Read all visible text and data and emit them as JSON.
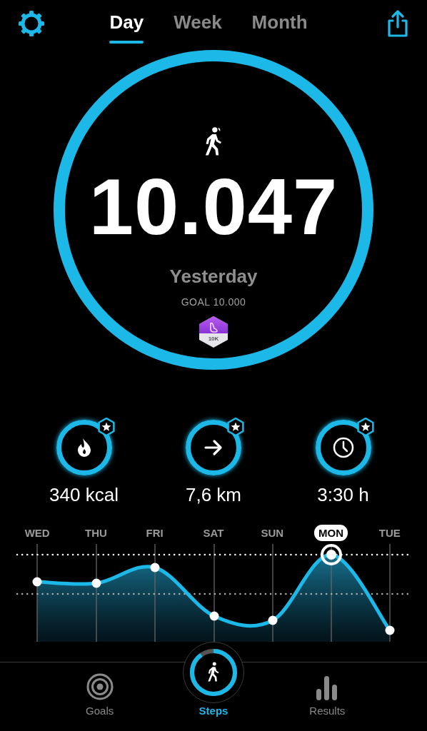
{
  "tabs": [
    {
      "label": "Day",
      "selected": true
    },
    {
      "label": "Week",
      "selected": false
    },
    {
      "label": "Month",
      "selected": false
    }
  ],
  "summary": {
    "level": 1,
    "steps": "10.047",
    "day": "Yesterday",
    "goal": "GOAL 10.000",
    "badge": "10K"
  },
  "metrics": [
    {
      "kind": "flame",
      "value": "340 kcal"
    },
    {
      "kind": "arrow",
      "value": "7,6 km"
    },
    {
      "kind": "clock",
      "value": "3:30 h"
    }
  ],
  "days": [
    {
      "label": "WED",
      "selected": false
    },
    {
      "label": "THU",
      "selected": false
    },
    {
      "label": "FRI",
      "selected": false
    },
    {
      "label": "SAT",
      "selected": false
    },
    {
      "label": "SUN",
      "selected": false
    },
    {
      "label": "MON",
      "selected": true
    },
    {
      "label": "TUE",
      "selected": false
    }
  ],
  "nav": [
    {
      "kind": "goals",
      "label": "Goals",
      "selected": false
    },
    {
      "kind": "steps",
      "label": "Steps",
      "selected": true
    },
    {
      "kind": "results",
      "label": "Results",
      "selected": false
    }
  ]
}
